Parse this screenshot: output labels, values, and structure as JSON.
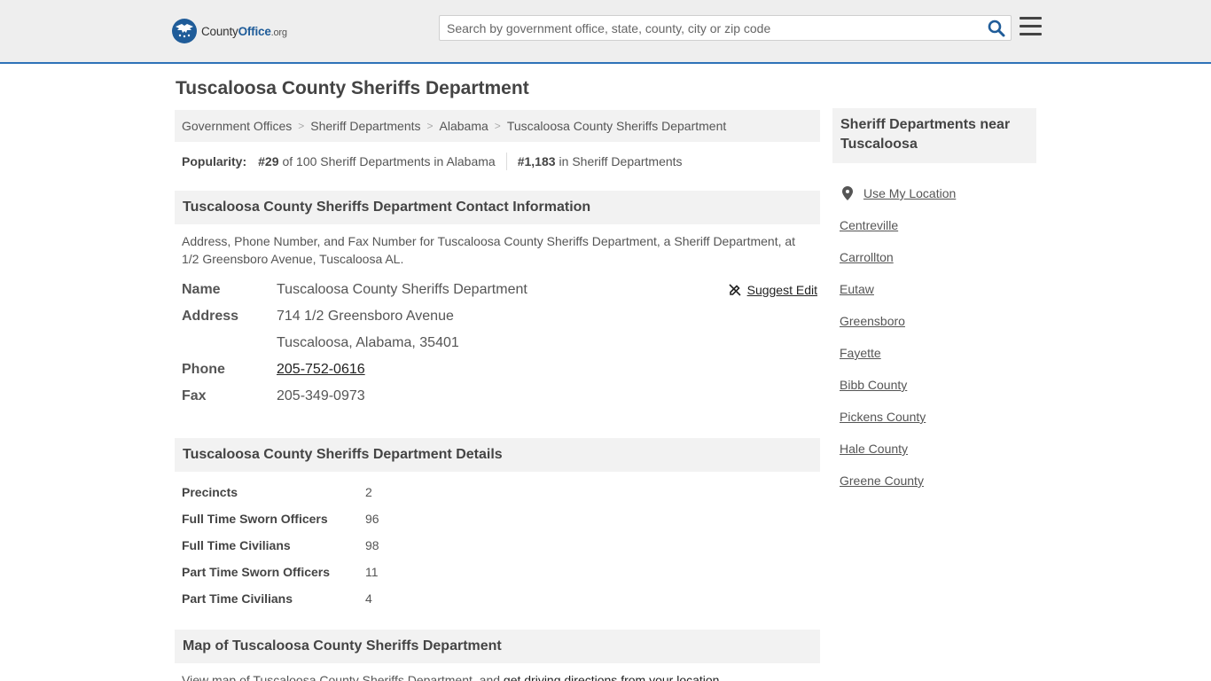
{
  "header": {
    "logo": {
      "word1": "County",
      "word2": "Office",
      "word3": ".org"
    },
    "search": {
      "placeholder": "Search by government office, state, county, city or zip code"
    }
  },
  "page": {
    "title": "Tuscaloosa County Sheriffs Department"
  },
  "breadcrumb": [
    "Government Offices",
    "Sheriff Departments",
    "Alabama",
    "Tuscaloosa County Sheriffs Department"
  ],
  "popularity": {
    "label": "Popularity:",
    "state_rank": "#29",
    "state_text": "of 100 Sheriff Departments in Alabama",
    "national_rank": "#1,183",
    "national_text": "in Sheriff Departments"
  },
  "contact": {
    "heading": "Tuscaloosa County Sheriffs Department Contact Information",
    "description": "Address, Phone Number, and Fax Number for Tuscaloosa County Sheriffs Department, a Sheriff Department, at 1/2 Greensboro Avenue, Tuscaloosa AL.",
    "suggest_edit": "Suggest Edit",
    "name_label": "Name",
    "name": "Tuscaloosa County Sheriffs Department",
    "address_label": "Address",
    "address_line1": "714 1/2 Greensboro Avenue",
    "address_line2": "Tuscaloosa, Alabama, 35401",
    "phone_label": "Phone",
    "phone": "205-752-0616",
    "fax_label": "Fax",
    "fax": "205-349-0973"
  },
  "details": {
    "heading": "Tuscaloosa County Sheriffs Department Details",
    "rows": [
      {
        "label": "Precincts",
        "value": "2"
      },
      {
        "label": "Full Time Sworn Officers",
        "value": "96"
      },
      {
        "label": "Full Time Civilians",
        "value": "98"
      },
      {
        "label": "Part Time Sworn Officers",
        "value": "11"
      },
      {
        "label": "Part Time Civilians",
        "value": "4"
      }
    ]
  },
  "map": {
    "heading": "Map of Tuscaloosa County Sheriffs Department",
    "text": "View map of Tuscaloosa County Sheriffs Department, and ",
    "link": "get driving directions from your location",
    "text_end": "."
  },
  "sidebar": {
    "heading": "Sheriff Departments near Tuscaloosa",
    "use_location": "Use My Location",
    "items": [
      "Centreville",
      "Carrollton",
      "Eutaw",
      "Greensboro",
      "Fayette",
      "Bibb County",
      "Pickens County",
      "Hale County",
      "Greene County"
    ]
  },
  "colors": {
    "accent": "#2e72b8",
    "logo_blue": "#1f5c99",
    "panel": "#f2f2f2",
    "header_bg": "#eeeeee"
  }
}
